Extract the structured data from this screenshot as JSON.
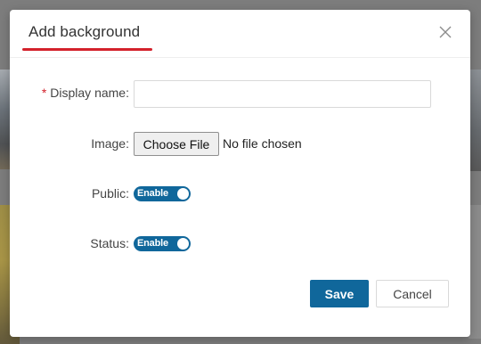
{
  "modal": {
    "title": "Add background",
    "close_icon": "close-icon"
  },
  "form": {
    "display_name": {
      "label": "Display name",
      "required_mark": "*",
      "value": "",
      "placeholder": ""
    },
    "image": {
      "label": "Image",
      "button_label": "Choose File",
      "status": "No file chosen"
    },
    "public": {
      "label": "Public",
      "state": "Enable",
      "on": true
    },
    "status": {
      "label": "Status",
      "state": "Enable",
      "on": true
    },
    "colon": ":"
  },
  "footer": {
    "save_label": "Save",
    "cancel_label": "Cancel"
  },
  "colors": {
    "accent": "#10679b",
    "title_underline": "#d3212b",
    "required": "#d3212b"
  }
}
